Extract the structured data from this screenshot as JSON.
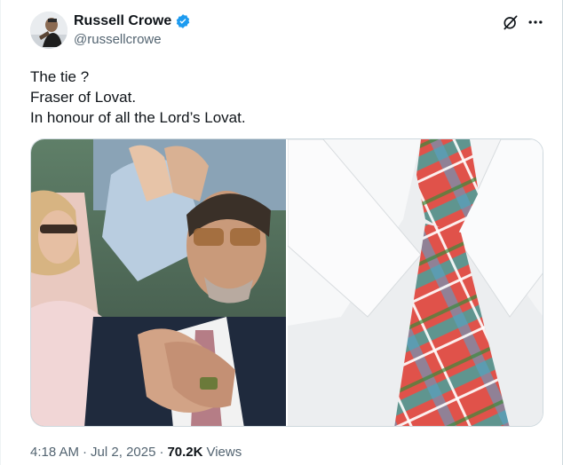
{
  "author": {
    "display_name": "Russell Crowe",
    "handle": "@russellcrowe",
    "verified": true,
    "verified_color": "#1d9bf0"
  },
  "header_icons": {
    "grok": "grok-icon",
    "more": "more-icon"
  },
  "tweet": {
    "lines": [
      "The tie ?",
      "Fraser of Lovat.",
      "In honour of all the Lord’s Lovat."
    ]
  },
  "media": {
    "images": [
      {
        "label": "photo-man-clapping-in-crowd"
      },
      {
        "label": "photo-tartan-tie-closeup"
      }
    ]
  },
  "meta": {
    "time": "4:18 AM",
    "separator": "·",
    "date": "Jul 2, 2025",
    "views_count": "70.2K",
    "views_label": "Views"
  },
  "colors": {
    "text_primary": "#0f1419",
    "text_secondary": "#536471",
    "border": "#cfd9de"
  }
}
